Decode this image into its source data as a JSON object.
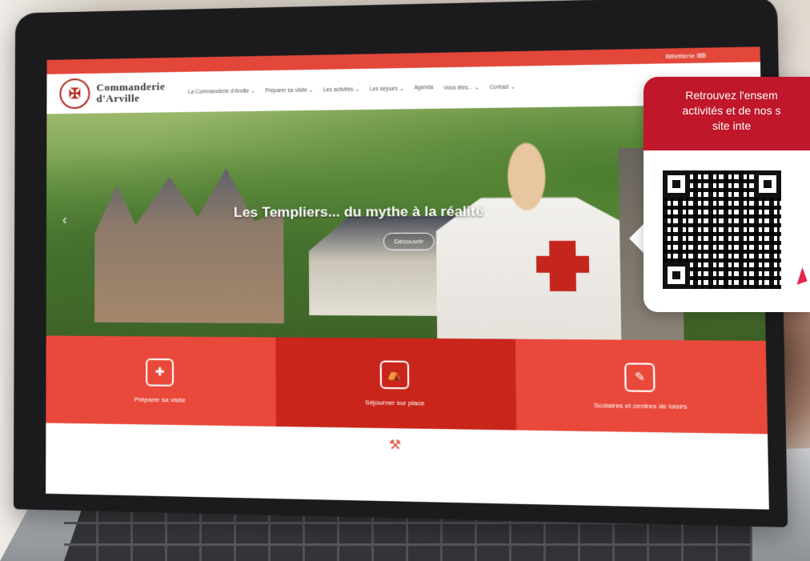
{
  "site": {
    "topbar": {
      "ticket_label": "Billetterie 🎟"
    },
    "logo": {
      "line1": "Commanderie",
      "line2": "d'Arville",
      "badge_icon": "✠"
    },
    "nav": [
      "La Commanderie d'Arville ⌄",
      "Préparer sa visite ⌄",
      "Les activités ⌄",
      "Les séjours ⌄",
      "Agenda",
      "Vous êtes... ⌄",
      "Contact ⌄"
    ],
    "hero": {
      "title": "Les Templiers... du mythe à la réalité",
      "button": "Découvrir",
      "prev_arrow": "‹"
    },
    "features": [
      {
        "label": "Préparer sa visite",
        "icon": "✚"
      },
      {
        "label": "Séjourner sur place",
        "icon": "⛺"
      },
      {
        "label": "Scolaires et centres de loisirs",
        "icon": "✎"
      }
    ],
    "below_icon": "⚒"
  },
  "callout": {
    "line1": "Retrouvez l'ensem",
    "line2": "activités et de nos s",
    "line3": "site inte"
  },
  "colors": {
    "brand_red": "#e2473a",
    "dark_red": "#c9251b",
    "callout_red": "#c0172a",
    "arrow_pink": "#e8234d"
  }
}
